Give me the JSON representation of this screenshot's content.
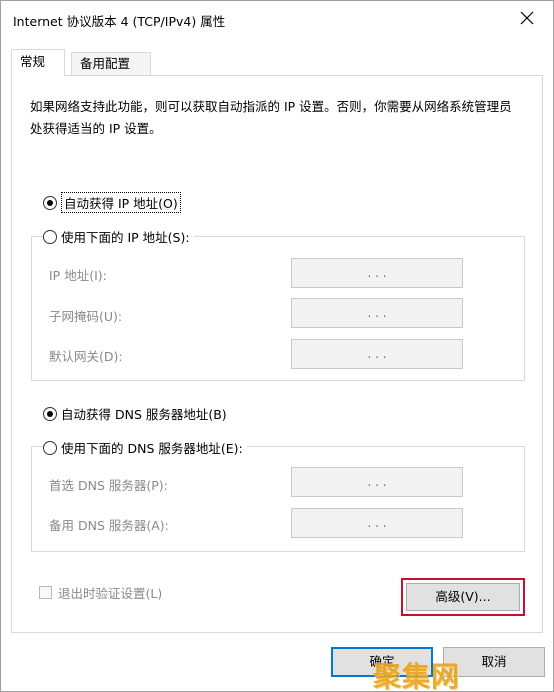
{
  "window": {
    "title": "Internet 协议版本 4 (TCP/IPv4) 属性"
  },
  "tabs": [
    {
      "label": "常规"
    },
    {
      "label": "备用配置"
    }
  ],
  "description": "如果网络支持此功能，则可以获取自动指派的 IP 设置。否则，你需要从网络系统管理员处获得适当的 IP 设置。",
  "ip": {
    "auto_label": "自动获得 IP 地址(O)",
    "manual_label": "使用下面的 IP 地址(S):",
    "selected": "auto",
    "fields": [
      {
        "label": "IP 地址(I):",
        "value": ".   .   ."
      },
      {
        "label": "子网掩码(U):",
        "value": ".   .   ."
      },
      {
        "label": "默认网关(D):",
        "value": ".   .   ."
      }
    ]
  },
  "dns": {
    "auto_label": "自动获得 DNS 服务器地址(B)",
    "manual_label": "使用下面的 DNS 服务器地址(E):",
    "selected": "auto",
    "fields": [
      {
        "label": "首选 DNS 服务器(P):",
        "value": ".   .   ."
      },
      {
        "label": "备用 DNS 服务器(A):",
        "value": ".   .   ."
      }
    ]
  },
  "validate_on_exit": {
    "label": "退出时验证设置(L)",
    "checked": false
  },
  "buttons": {
    "advanced": "高级(V)...",
    "ok": "确定",
    "cancel": "取消"
  },
  "watermark": "聚集网",
  "colors": {
    "highlight_border": "#c8102e",
    "default_button_border": "#0078d7",
    "watermark": "#e8a31a"
  }
}
